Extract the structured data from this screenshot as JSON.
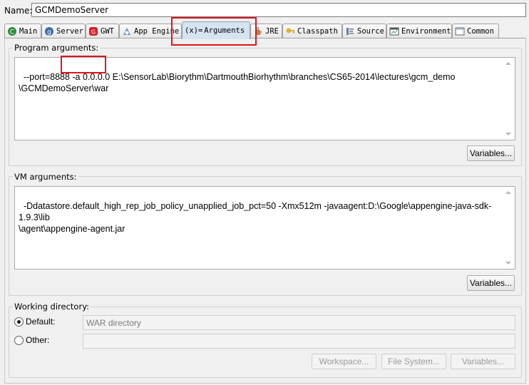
{
  "name": {
    "label": "Name:",
    "value": "GCMDemoServer"
  },
  "tabs": [
    {
      "label": "Main",
      "icon": "main-icon"
    },
    {
      "label": "Server",
      "icon": "server-icon"
    },
    {
      "label": "GWT",
      "icon": "gwt-icon"
    },
    {
      "label": "App Engine",
      "icon": "app-engine-icon"
    },
    {
      "label": "Arguments",
      "icon": "arguments-icon",
      "prefix": "(x)="
    },
    {
      "label": "JRE",
      "icon": "jre-icon"
    },
    {
      "label": "Classpath",
      "icon": "classpath-icon"
    },
    {
      "label": "Source",
      "icon": "source-icon"
    },
    {
      "label": "Environment",
      "icon": "environment-icon"
    },
    {
      "label": "Common",
      "icon": "common-icon"
    }
  ],
  "program_args": {
    "label": "Program arguments:",
    "value": "--port=8888 -a 0.0.0.0 E:\\SensorLab\\Biorythm\\DartmouthBiorhythm\\branches\\CS65-2014\\lectures\\gcm_demo\n\\GCMDemoServer\\war",
    "variables_label": "Variables..."
  },
  "vm_args": {
    "label": "VM arguments:",
    "value": "-Ddatastore.default_high_rep_job_policy_unapplied_job_pct=50 -Xmx512m -javaagent:D:\\Google\\appengine-java-sdk-1.9.3\\lib\n\\agent\\appengine-agent.jar",
    "variables_label": "Variables..."
  },
  "working_dir": {
    "label": "Working directory:",
    "default_label": "Default:",
    "default_value": "WAR directory",
    "other_label": "Other:",
    "other_value": "",
    "workspace_label": "Workspace...",
    "filesystem_label": "File System...",
    "variables_label": "Variables..."
  },
  "colors": {
    "highlight": "#e0141e",
    "active_tab": "#d6e3f1"
  }
}
